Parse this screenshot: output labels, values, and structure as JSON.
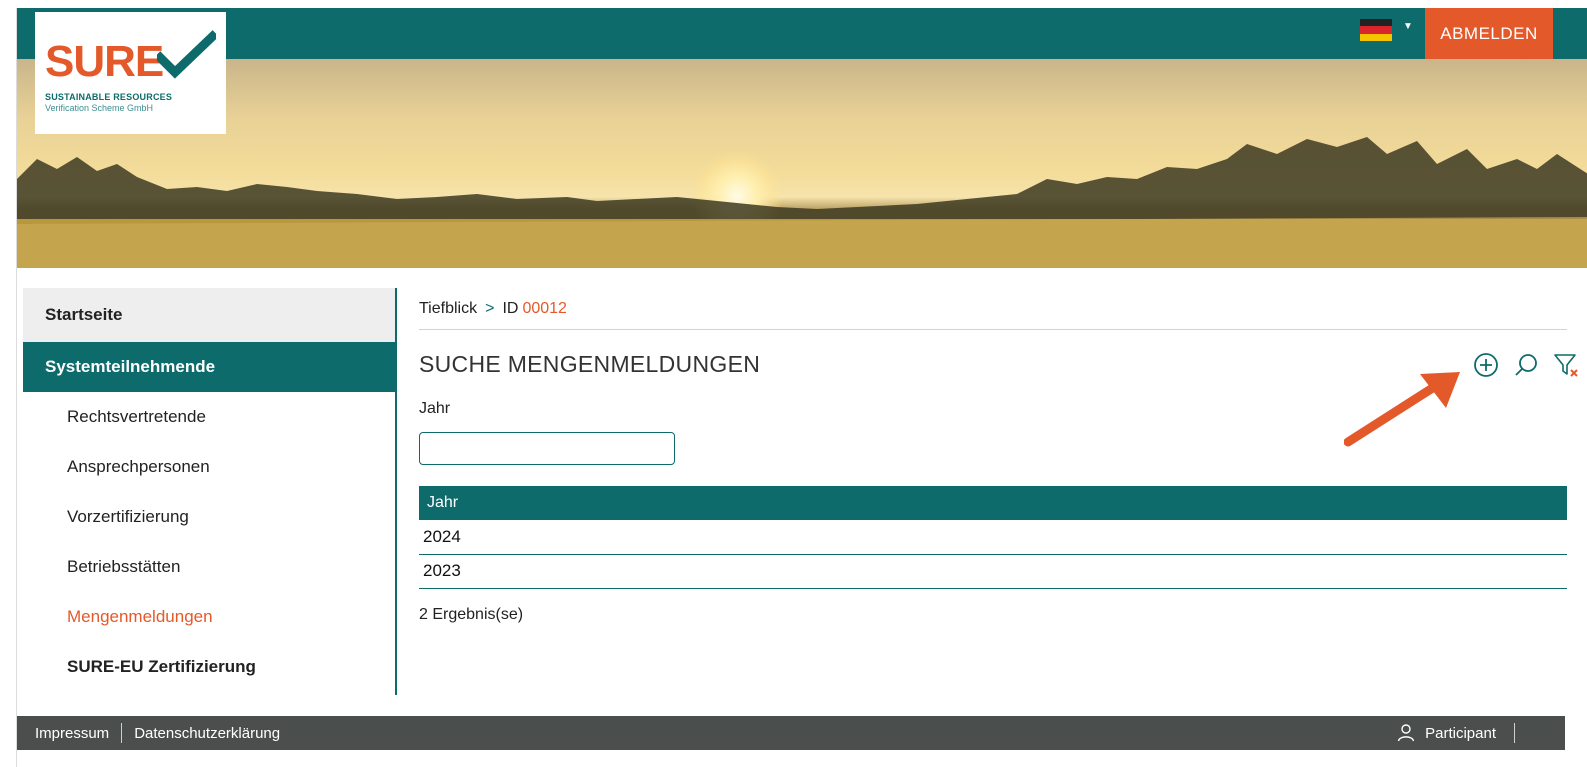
{
  "header": {
    "logo": {
      "brand": "SURE",
      "line1": "SUSTAINABLE RESOURCES",
      "line2": "Verification Scheme GmbH"
    },
    "language_icon": "germany-flag-icon",
    "logout_label": "ABMELDEN",
    "colors": {
      "primary": "#0e6b6b",
      "accent": "#e4592a"
    }
  },
  "sidebar": {
    "items": [
      {
        "label": "Startseite"
      },
      {
        "label": "Systemteilnehmende"
      },
      {
        "label": "Rechtsvertretende"
      },
      {
        "label": "Ansprechpersonen"
      },
      {
        "label": "Vorzertifizierung"
      },
      {
        "label": "Betriebsstätten"
      },
      {
        "label": "Mengenmeldungen"
      },
      {
        "label": "SURE-EU Zertifizierung"
      }
    ]
  },
  "breadcrumb": {
    "root": "Tiefblick",
    "separator": ">",
    "id_label": "ID",
    "id_value": "00012"
  },
  "main": {
    "title": "SUCHE MENGENMELDUNGEN",
    "tools": [
      "plus-circle-icon",
      "search-icon",
      "clear-filter-icon"
    ],
    "filter": {
      "label": "Jahr",
      "value": "",
      "placeholder": ""
    },
    "table": {
      "columns": [
        "Jahr"
      ],
      "rows": [
        [
          "2024"
        ],
        [
          "2023"
        ]
      ]
    },
    "result_count": "2 Ergebnis(se)"
  },
  "footer": {
    "links": [
      "Impressum",
      "Datenschutzerklärung"
    ],
    "user_icon": "user-icon",
    "user_role": "Participant"
  }
}
